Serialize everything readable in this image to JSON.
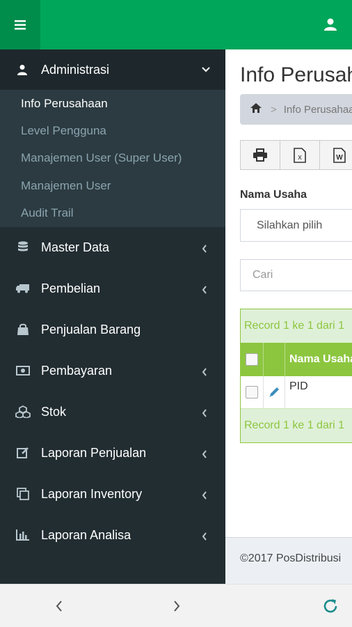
{
  "sidebar": {
    "section": {
      "label": "Administrasi",
      "icon": "user-icon"
    },
    "submenu": [
      {
        "label": "Info Perusahaan",
        "active": true
      },
      {
        "label": "Level Pengguna"
      },
      {
        "label": "Manajemen User (Super User)"
      },
      {
        "label": "Manajemen User"
      },
      {
        "label": "Audit Trail"
      }
    ],
    "items": [
      {
        "label": "Master Data",
        "icon": "database-icon",
        "has_children": true
      },
      {
        "label": "Pembelian",
        "icon": "truck-icon",
        "has_children": true
      },
      {
        "label": "Penjualan Barang",
        "icon": "shopping-bag-icon",
        "has_children": false
      },
      {
        "label": "Pembayaran",
        "icon": "money-icon",
        "has_children": true
      },
      {
        "label": "Stok",
        "icon": "cubes-icon",
        "has_children": true
      },
      {
        "label": "Laporan Penjualan",
        "icon": "edit-icon",
        "has_children": true
      },
      {
        "label": "Laporan Inventory",
        "icon": "clone-icon",
        "has_children": true
      },
      {
        "label": "Laporan Analisa",
        "icon": "bar-chart-icon",
        "has_children": true
      }
    ]
  },
  "main": {
    "title": "Info Perusahaan",
    "breadcrumb": "Info Perusahaan",
    "export_buttons": [
      "print-icon",
      "excel-icon",
      "word-icon"
    ],
    "filter_label": "Nama Usaha",
    "select_value": "Silahkan pilih",
    "search_placeholder": "Cari",
    "record_text": "Record 1 ke 1 dari 1",
    "column_header": "Nama Usaha",
    "rows": [
      {
        "name": "PID"
      }
    ],
    "footer": "©2017 PosDistribusi"
  },
  "colors": {
    "topbar": "#00a65a",
    "sidebar": "#222d32",
    "table_accent": "#8cc63f"
  }
}
